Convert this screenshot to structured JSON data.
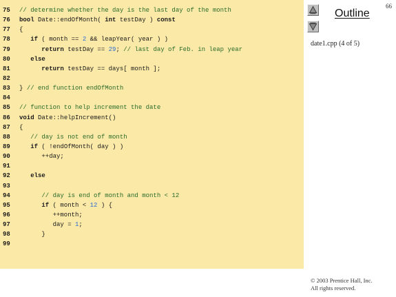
{
  "page_number": "66",
  "outline": {
    "title": "Outline",
    "file_label": "date1.cpp (4 of 5)"
  },
  "nav": {
    "up_icon": "triangle-up-icon",
    "down_icon": "triangle-down-icon"
  },
  "colors": {
    "code_background": "#fbe9a7",
    "comment": "#2a6a2a",
    "number": "#2a6ad4",
    "button_face": "#bfbfbf"
  },
  "code": [
    {
      "num": "75",
      "tokens": [
        {
          "t": "// determine whether the day is the last day of the month",
          "k": "comment"
        }
      ]
    },
    {
      "num": "76",
      "tokens": [
        {
          "t": "bool",
          "k": "keyword"
        },
        {
          "t": " Date::endOfMonth( ",
          "k": "plain"
        },
        {
          "t": "int",
          "k": "keyword"
        },
        {
          "t": " testDay ) ",
          "k": "plain"
        },
        {
          "t": "const",
          "k": "keyword"
        }
      ]
    },
    {
      "num": "77",
      "tokens": [
        {
          "t": "{",
          "k": "plain"
        }
      ]
    },
    {
      "num": "78",
      "tokens": [
        {
          "t": "   ",
          "k": "plain"
        },
        {
          "t": "if",
          "k": "keyword"
        },
        {
          "t": " ( month == ",
          "k": "plain"
        },
        {
          "t": "2",
          "k": "number"
        },
        {
          "t": " && leapYear( year ) )",
          "k": "plain"
        }
      ]
    },
    {
      "num": "79",
      "tokens": [
        {
          "t": "      ",
          "k": "plain"
        },
        {
          "t": "return",
          "k": "keyword"
        },
        {
          "t": " testDay == ",
          "k": "plain"
        },
        {
          "t": "29",
          "k": "number"
        },
        {
          "t": "; ",
          "k": "plain"
        },
        {
          "t": "// last day of Feb. in leap year",
          "k": "comment"
        }
      ]
    },
    {
      "num": "80",
      "tokens": [
        {
          "t": "   ",
          "k": "plain"
        },
        {
          "t": "else",
          "k": "keyword"
        }
      ]
    },
    {
      "num": "81",
      "tokens": [
        {
          "t": "      ",
          "k": "plain"
        },
        {
          "t": "return",
          "k": "keyword"
        },
        {
          "t": " testDay == days[ month ];",
          "k": "plain"
        }
      ]
    },
    {
      "num": "82",
      "tokens": []
    },
    {
      "num": "83",
      "tokens": [
        {
          "t": "} ",
          "k": "plain"
        },
        {
          "t": "// end function endOfMonth",
          "k": "comment"
        }
      ]
    },
    {
      "num": "84",
      "tokens": []
    },
    {
      "num": "85",
      "tokens": [
        {
          "t": "// function to help increment the date",
          "k": "comment"
        }
      ]
    },
    {
      "num": "86",
      "tokens": [
        {
          "t": "void",
          "k": "keyword"
        },
        {
          "t": " Date::helpIncrement()",
          "k": "plain"
        }
      ]
    },
    {
      "num": "87",
      "tokens": [
        {
          "t": "{",
          "k": "plain"
        }
      ]
    },
    {
      "num": "88",
      "tokens": [
        {
          "t": "   ",
          "k": "plain"
        },
        {
          "t": "// day is not end of month",
          "k": "comment"
        }
      ]
    },
    {
      "num": "89",
      "tokens": [
        {
          "t": "   ",
          "k": "plain"
        },
        {
          "t": "if",
          "k": "keyword"
        },
        {
          "t": " ( !endOfMonth( day ) )",
          "k": "plain"
        }
      ]
    },
    {
      "num": "90",
      "tokens": [
        {
          "t": "      ++day;",
          "k": "plain"
        }
      ]
    },
    {
      "num": "91",
      "tokens": []
    },
    {
      "num": "92",
      "tokens": [
        {
          "t": "   ",
          "k": "plain"
        },
        {
          "t": "else",
          "k": "keyword"
        }
      ]
    },
    {
      "num": "93",
      "tokens": []
    },
    {
      "num": "94",
      "tokens": [
        {
          "t": "      ",
          "k": "plain"
        },
        {
          "t": "// day is end of month and month < 12",
          "k": "comment"
        }
      ]
    },
    {
      "num": "95",
      "tokens": [
        {
          "t": "      ",
          "k": "plain"
        },
        {
          "t": "if",
          "k": "keyword"
        },
        {
          "t": " ( month < ",
          "k": "plain"
        },
        {
          "t": "12",
          "k": "number"
        },
        {
          "t": " ) {",
          "k": "plain"
        }
      ]
    },
    {
      "num": "96",
      "tokens": [
        {
          "t": "         ++month;",
          "k": "plain"
        }
      ]
    },
    {
      "num": "97",
      "tokens": [
        {
          "t": "         day = ",
          "k": "plain"
        },
        {
          "t": "1",
          "k": "number"
        },
        {
          "t": ";",
          "k": "plain"
        }
      ]
    },
    {
      "num": "98",
      "tokens": [
        {
          "t": "      }",
          "k": "plain"
        }
      ]
    },
    {
      "num": "99",
      "tokens": []
    }
  ],
  "copyright": {
    "line1": "© 2003 Prentice Hall, Inc.",
    "line2": "All rights reserved."
  }
}
